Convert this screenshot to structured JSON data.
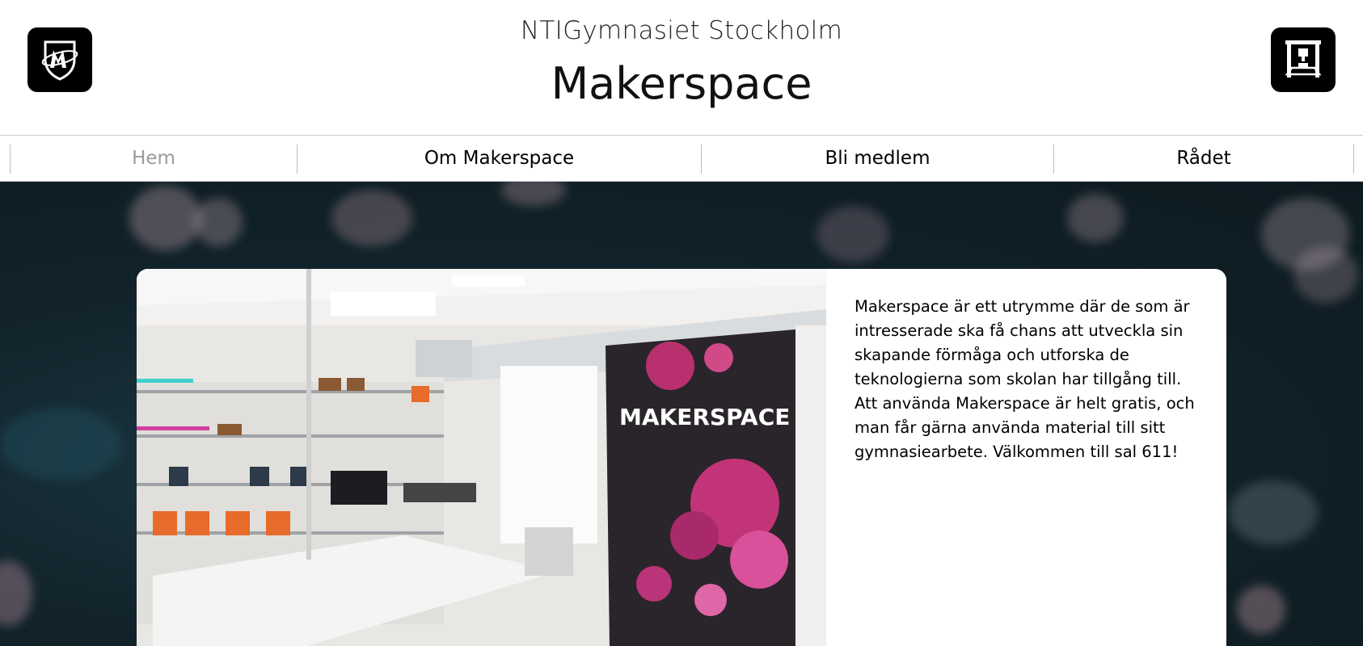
{
  "header": {
    "school_name": "NTIGymnasiet Stockholm",
    "site_title": "Makerspace",
    "left_logo_icon": "makerspace-shield-logo-icon",
    "right_logo_icon": "3d-printer-icon"
  },
  "nav": {
    "items": [
      {
        "label": "Hem",
        "active": true
      },
      {
        "label": "Om Makerspace",
        "active": false
      },
      {
        "label": "Bli medlem",
        "active": false
      },
      {
        "label": "Rådet",
        "active": false
      }
    ]
  },
  "main": {
    "photo_banner_text": "MAKERSPACE",
    "description": "Makerspace är ett utrymme där de som är intresserade ska få chans att utveckla sin skapande förmåga och utforska de teknologierna som skolan har tillgång till. Att använda Makerspace är helt gratis, och man får gärna använda material till sitt gymnasiearbete. Välkommen till sal 611!"
  },
  "colors": {
    "nav_active": "#9a9a9a",
    "hero_background": "#12232b",
    "logo_background": "#000000"
  }
}
